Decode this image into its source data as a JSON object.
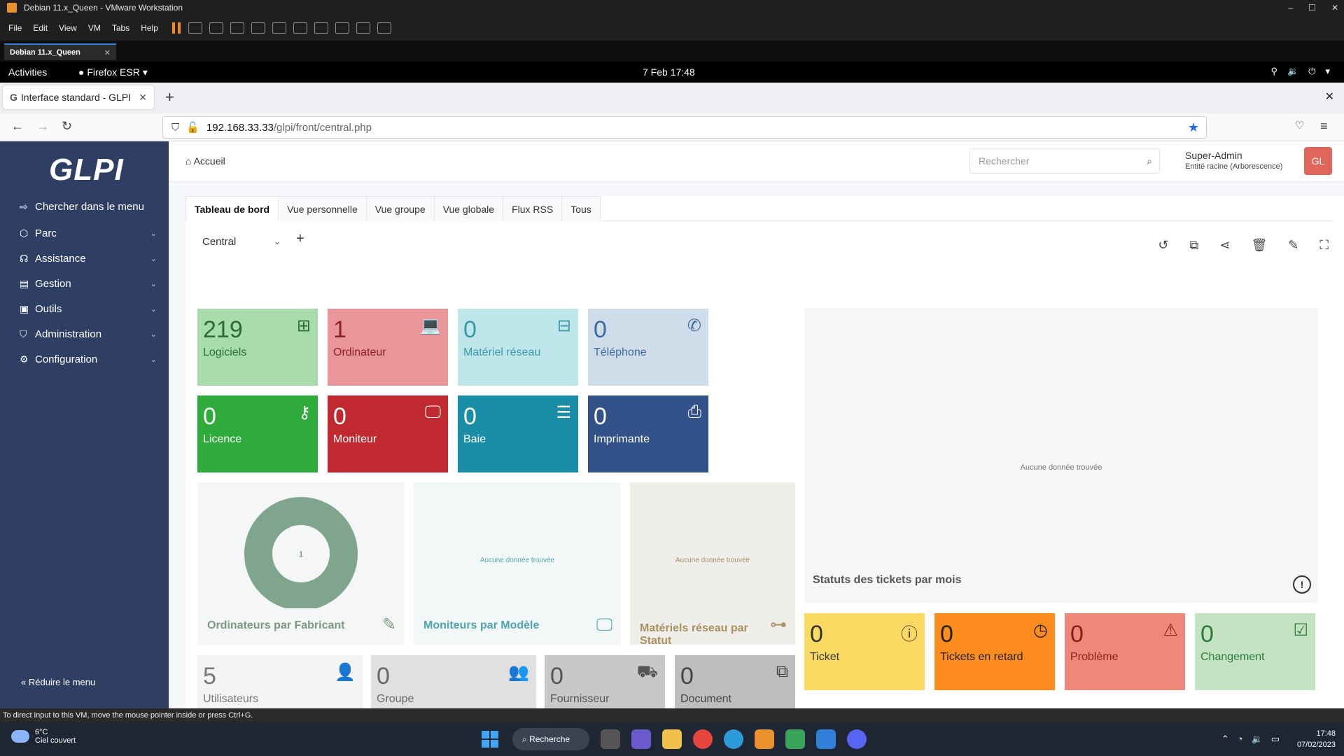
{
  "vm": {
    "title": "Debian 11.x_Queen - VMware Workstation",
    "menu": [
      "File",
      "Edit",
      "View",
      "VM",
      "Tabs",
      "Help"
    ],
    "tab_label": "Debian 11.x_Queen",
    "status_text": "To direct input to this VM, move the mouse pointer inside or press Ctrl+G."
  },
  "gnome": {
    "activities": "Activities",
    "app": "Firefox ESR",
    "clock": "7 Feb  17:48"
  },
  "firefox": {
    "tab_title": "Interface standard - GLPI",
    "url_host": "192.168.33.33",
    "url_path": "/glpi/front/central.php"
  },
  "glpi": {
    "logo": "GLPI",
    "breadcrumb": "Accueil",
    "search_placeholder": "Rechercher",
    "user_name": "Super-Admin",
    "user_entity": "Entité racine (Arborescence)",
    "avatar_initials": "GL",
    "menu": [
      {
        "label": "Chercher dans le menu",
        "icon": "arrow-right-icon"
      },
      {
        "label": "Parc",
        "icon": "box-icon"
      },
      {
        "label": "Assistance",
        "icon": "headset-icon"
      },
      {
        "label": "Gestion",
        "icon": "wallet-icon"
      },
      {
        "label": "Outils",
        "icon": "briefcase-icon"
      },
      {
        "label": "Administration",
        "icon": "shield-icon"
      },
      {
        "label": "Configuration",
        "icon": "gear-icon"
      }
    ],
    "reduce_menu": "Réduire le menu",
    "tabs": [
      "Tableau de bord",
      "Vue personnelle",
      "Vue groupe",
      "Vue globale",
      "Flux RSS",
      "Tous"
    ],
    "dashboard_select": "Central",
    "tiles": [
      {
        "value": "219",
        "label": "Logiciels",
        "icon": "apps-add-icon",
        "bg": "#a8dcaa",
        "fg": "#2e6b34"
      },
      {
        "value": "1",
        "label": "Ordinateur",
        "icon": "laptop-icon",
        "bg": "#e9969a",
        "fg": "#8a2027"
      },
      {
        "value": "0",
        "label": "Matériel réseau",
        "icon": "network-icon",
        "bg": "#bfe6ea",
        "fg": "#3a9aa8"
      },
      {
        "value": "0",
        "label": "Téléphone",
        "icon": "phone-icon",
        "bg": "#cfdcea",
        "fg": "#3d6aa3"
      },
      {
        "value": "0",
        "label": "Licence",
        "icon": "key-icon",
        "bg": "#2eab3a",
        "fg": "#ffffff"
      },
      {
        "value": "0",
        "label": "Moniteur",
        "icon": "monitor-icon",
        "bg": "#c02930",
        "fg": "#ffffff"
      },
      {
        "value": "0",
        "label": "Baie",
        "icon": "server-icon",
        "bg": "#1a8ea6",
        "fg": "#ffffff"
      },
      {
        "value": "0",
        "label": "Imprimante",
        "icon": "printer-icon",
        "bg": "#34528a",
        "fg": "#ffffff"
      }
    ],
    "pie_cards": [
      {
        "title": "Ordinateurs par Fabricant",
        "icon": "edit-icon",
        "center": "1",
        "bg": "#f5f6f7",
        "fg": "#7a9a80"
      },
      {
        "title": "Moniteurs par Modèle",
        "icon": "monitor-icon",
        "nodata": "Aucune donnée trouvée",
        "bg": "#f2f7f8",
        "fg": "#4ea4b2"
      },
      {
        "title": "Matériels réseau par Statut",
        "icon": "tree-icon",
        "nodata": "Aucune donnée trouvée",
        "bg": "#f0eeea",
        "fg": "#a9905e"
      }
    ],
    "chart_big": {
      "title": "Statuts des tickets par mois",
      "nodata": "Aucune donnée trouvée"
    },
    "ticket_tiles": [
      {
        "value": "0",
        "label": "Ticket",
        "icon": "alert-circle-icon",
        "bg": "#fcd962",
        "fg": "#333333"
      },
      {
        "value": "0",
        "label": "Tickets en retard",
        "icon": "clock-icon",
        "bg": "#fb8c1d",
        "fg": "#222222"
      },
      {
        "value": "0",
        "label": "Problème",
        "icon": "warning-icon",
        "bg": "#f0877b",
        "fg": "#8a1e16"
      },
      {
        "value": "0",
        "label": "Changement",
        "icon": "clipboard-check-icon",
        "bg": "#c3e3c3",
        "fg": "#2e7a3a"
      }
    ],
    "bottom_tiles": [
      {
        "value": "5",
        "label": "Utilisateurs",
        "icon": "user-icon",
        "bg": "#f4f4f4",
        "fg": "#777777"
      },
      {
        "value": "0",
        "label": "Groupe",
        "icon": "users-icon",
        "bg": "#e0e0e0",
        "fg": "#666666"
      },
      {
        "value": "0",
        "label": "Fournisseur",
        "icon": "truck-icon",
        "bg": "#c8c8c8",
        "fg": "#555555"
      },
      {
        "value": "0",
        "label": "Document",
        "icon": "files-icon",
        "bg": "#bdbdbd",
        "fg": "#444444"
      }
    ]
  },
  "windows": {
    "temp": "6°C",
    "weather": "Ciel couvert",
    "search": "Recherche",
    "time": "17:48",
    "date": "07/02/2023"
  }
}
